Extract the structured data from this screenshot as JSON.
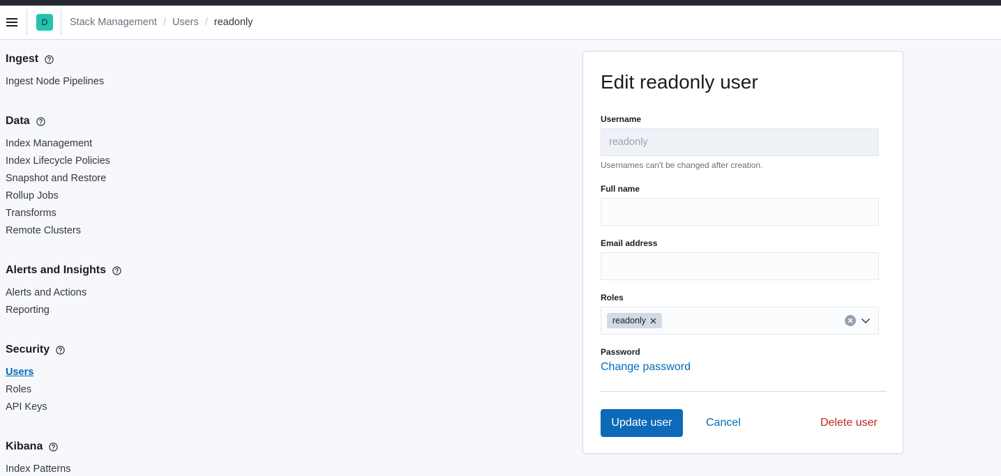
{
  "header": {
    "space_initial": "D",
    "breadcrumbs": [
      "Stack Management",
      "Users",
      "readonly"
    ]
  },
  "sidenav": {
    "groups": [
      {
        "title": "Ingest",
        "items": [
          "Ingest Node Pipelines"
        ]
      },
      {
        "title": "Data",
        "items": [
          "Index Management",
          "Index Lifecycle Policies",
          "Snapshot and Restore",
          "Rollup Jobs",
          "Transforms",
          "Remote Clusters"
        ]
      },
      {
        "title": "Alerts and Insights",
        "items": [
          "Alerts and Actions",
          "Reporting"
        ]
      },
      {
        "title": "Security",
        "items": [
          "Users",
          "Roles",
          "API Keys"
        ],
        "active_item": "Users"
      },
      {
        "title": "Kibana",
        "items": [
          "Index Patterns"
        ]
      }
    ]
  },
  "form": {
    "title": "Edit readonly user",
    "username": {
      "label": "Username",
      "value": "readonly",
      "help": "Usernames can't be changed after creation."
    },
    "full_name": {
      "label": "Full name",
      "value": ""
    },
    "email": {
      "label": "Email address",
      "value": ""
    },
    "roles": {
      "label": "Roles",
      "selected": [
        "readonly"
      ]
    },
    "password": {
      "label": "Password",
      "link": "Change password"
    },
    "buttons": {
      "update": "Update user",
      "cancel": "Cancel",
      "delete": "Delete user"
    }
  },
  "colors": {
    "primary": "#0c6ab8",
    "link": "#006bb8",
    "danger": "#bd271e",
    "space_avatar": "#20c4b0",
    "topbar": "#25282f"
  }
}
